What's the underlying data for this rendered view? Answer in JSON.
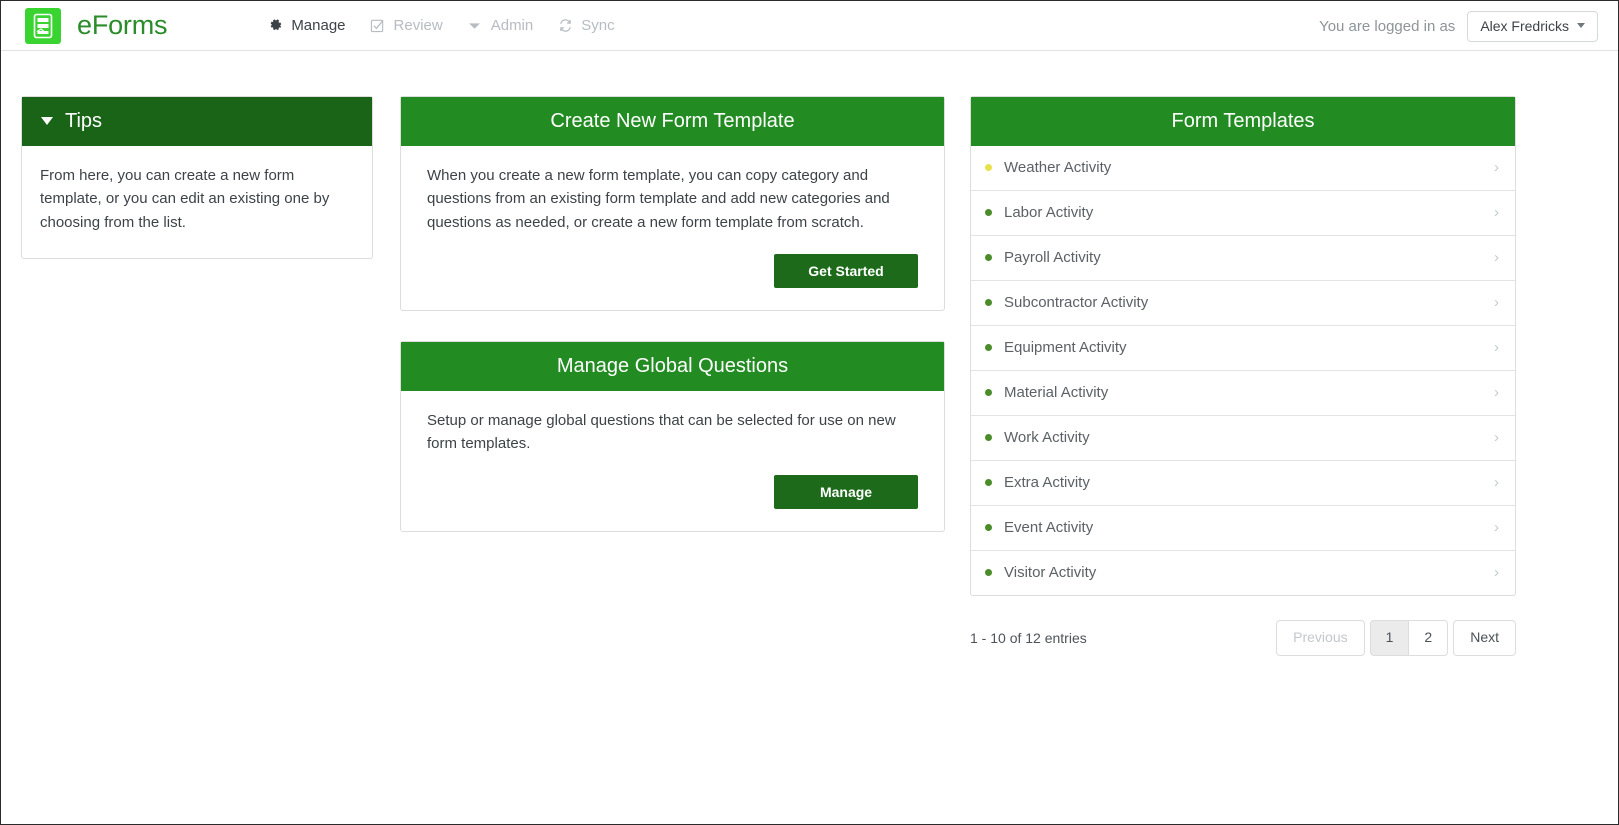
{
  "app": {
    "brand_name": "eForms",
    "logo_icon": "form-document-icon",
    "logo_color": "#3ad431",
    "brand_text_color": "#2a8c2a"
  },
  "nav": {
    "items": [
      {
        "label": "Manage",
        "icon": "gear-icon",
        "active": true
      },
      {
        "label": "Review",
        "icon": "checkbox-icon",
        "active": false
      },
      {
        "label": "Admin",
        "icon": "caret-down-icon",
        "active": false
      },
      {
        "label": "Sync",
        "icon": "sync-icon",
        "active": false
      }
    ]
  },
  "account": {
    "logged_in_text": "You are logged in as",
    "user_name": "Alex Fredricks",
    "dropdown_icon": "caret-down-icon"
  },
  "tips": {
    "title": "Tips",
    "toggle_icon": "caret-down-icon",
    "body": "From here, you can create a new form template, or you can edit an existing one by choosing from the list.",
    "header_color": "#1a6418"
  },
  "create_template": {
    "title": "Create New Form Template",
    "body": "When you create a new form template, you can copy category and questions from an existing form template and add new categories and questions as needed, or create a new form template from scratch.",
    "button_label": "Get Started",
    "header_color": "#228b22",
    "button_color": "#1d6b1a"
  },
  "global_questions": {
    "title": "Manage Global Questions",
    "body": "Setup or manage global questions that can be selected for use on new form templates.",
    "button_label": "Manage",
    "header_color": "#228b22",
    "button_color": "#1d6b1a"
  },
  "form_templates": {
    "title": "Form Templates",
    "header_color": "#228b22",
    "chevron_icon": "chevron-right-icon",
    "items": [
      {
        "label": "Weather Activity",
        "dot_color": "#e8e04a"
      },
      {
        "label": "Labor Activity",
        "dot_color": "#4a8c2a"
      },
      {
        "label": "Payroll Activity",
        "dot_color": "#4a8c2a"
      },
      {
        "label": "Subcontractor Activity",
        "dot_color": "#4a8c2a"
      },
      {
        "label": "Equipment Activity",
        "dot_color": "#4a8c2a"
      },
      {
        "label": "Material Activity",
        "dot_color": "#4a8c2a"
      },
      {
        "label": "Work Activity",
        "dot_color": "#4a8c2a"
      },
      {
        "label": "Extra Activity",
        "dot_color": "#4a8c2a"
      },
      {
        "label": "Event Activity",
        "dot_color": "#4a8c2a"
      },
      {
        "label": "Visitor Activity",
        "dot_color": "#4a8c2a"
      }
    ],
    "entries_info": "1 - 10 of 12 entries",
    "pagination": {
      "previous_label": "Previous",
      "next_label": "Next",
      "pages": [
        "1",
        "2"
      ],
      "current_page": "1"
    }
  }
}
